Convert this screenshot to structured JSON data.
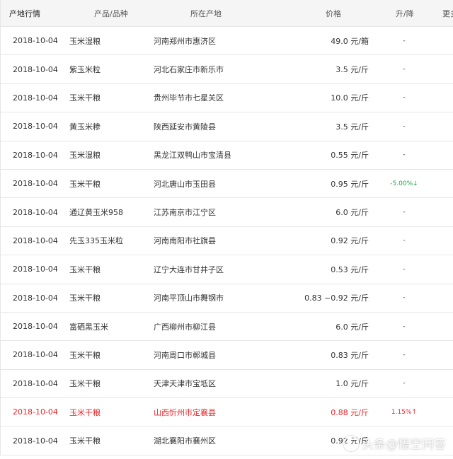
{
  "header": {
    "date": "产地行情",
    "product": "产品/品种",
    "location": "所在产地",
    "price": "价格",
    "change": "升/降",
    "more": "更多"
  },
  "rows": [
    {
      "date": "2018-10-04",
      "product": "玉米湿粮",
      "location": "河南郑州市惠济区",
      "price": "49.0 元/箱",
      "change": "-"
    },
    {
      "date": "2018-10-04",
      "product": "紫玉米粒",
      "location": "河北石家庄市新乐市",
      "price": "3.5 元/斤",
      "change": "-"
    },
    {
      "date": "2018-10-04",
      "product": "玉米干粮",
      "location": "贵州毕节市七星关区",
      "price": "10.0 元/斤",
      "change": "-"
    },
    {
      "date": "2018-10-04",
      "product": "黄玉米糁",
      "location": "陕西延安市黄陵县",
      "price": "3.5 元/斤",
      "change": "-"
    },
    {
      "date": "2018-10-04",
      "product": "玉米湿粮",
      "location": "黑龙江双鸭山市宝清县",
      "price": "0.55 元/斤",
      "change": "-"
    },
    {
      "date": "2018-10-04",
      "product": "玉米干粮",
      "location": "河北唐山市玉田县",
      "price": "0.95 元/斤",
      "change": "-5.00%↓"
    },
    {
      "date": "2018-10-04",
      "product": "通辽黄玉米958",
      "location": "江苏南京市江宁区",
      "price": "6.0 元/斤",
      "change": "-"
    },
    {
      "date": "2018-10-04",
      "product": "先玉335玉米粒",
      "location": "河南南阳市社旗县",
      "price": "0.92 元/斤",
      "change": "-"
    },
    {
      "date": "2018-10-04",
      "product": "玉米干粮",
      "location": "辽宁大连市甘井子区",
      "price": "0.53 元/斤",
      "change": "-"
    },
    {
      "date": "2018-10-04",
      "product": "玉米干粮",
      "location": "河南平顶山市舞钢市",
      "price": "0.83 ~0.92 元/斤",
      "change": "-"
    },
    {
      "date": "2018-10-04",
      "product": "富硒黑玉米",
      "location": "广西柳州市柳江县",
      "price": "6.0 元/斤",
      "change": "-"
    },
    {
      "date": "2018-10-04",
      "product": "玉米干粮",
      "location": "河南周口市郸城县",
      "price": "0.83 元/斤",
      "change": "-"
    },
    {
      "date": "2018-10-04",
      "product": "玉米干粮",
      "location": "天津天津市宝坻区",
      "price": "1.0 元/斤",
      "change": "-"
    },
    {
      "date": "2018-10-04",
      "product": "玉米干粮",
      "location": "山西忻州市定襄县",
      "price": "0.88 元/斤",
      "change": "1.15%↑"
    },
    {
      "date": "2018-10-04",
      "product": "玉米干粮",
      "location": "湖北襄阳市襄州区",
      "price": "0.92 元/斤",
      "change": ""
    }
  ],
  "watermark": "头条@悟空问答",
  "colors": {
    "header_bg": "#f5f5f5",
    "border": "#e6e6e6",
    "text": "#333333",
    "rise": "#e8252a",
    "fall": "#1aa34a"
  }
}
